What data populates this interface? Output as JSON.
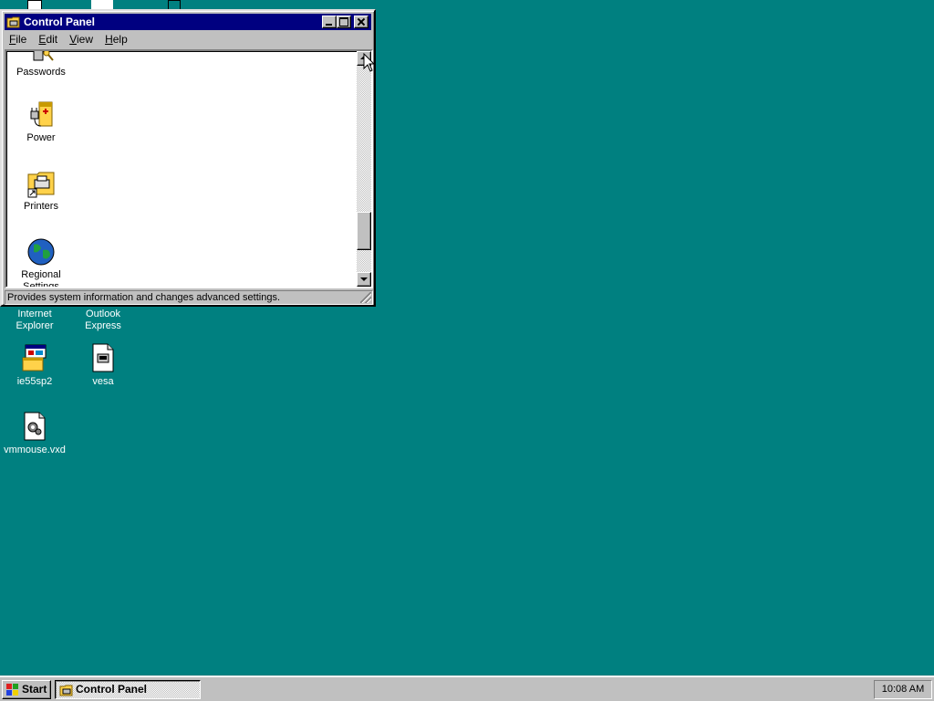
{
  "desktop": {
    "background_color": "#008080",
    "icons": [
      {
        "label_line1": "Internet",
        "label_line2": "Explorer",
        "icon": "internet-explorer-icon"
      },
      {
        "label_line1": "Outlook",
        "label_line2": "Express",
        "icon": "outlook-express-icon"
      },
      {
        "label_line1": "ie55sp2",
        "icon": "setup-program-icon"
      },
      {
        "label_line1": "vesa",
        "icon": "text-document-icon"
      },
      {
        "label_line1": "vmmouse.vxd",
        "icon": "system-file-icon"
      }
    ]
  },
  "window": {
    "title": "Control Panel",
    "title_icon": "control-panel-icon",
    "menu": [
      {
        "accel": "F",
        "rest": "ile"
      },
      {
        "accel": "E",
        "rest": "dit"
      },
      {
        "accel": "V",
        "rest": "iew"
      },
      {
        "accel": "H",
        "rest": "elp"
      }
    ],
    "items": [
      {
        "label": "Passwords",
        "icon": "passwords-keys-icon"
      },
      {
        "label": "Power",
        "icon": "power-plug-icon"
      },
      {
        "label": "Printers",
        "icon": "printers-folder-icon"
      },
      {
        "label_line1": "Regional",
        "label_line2": "Settings",
        "icon": "globe-icon"
      }
    ],
    "status_text": "Provides system information and changes advanced settings.",
    "accent_color": "#000080"
  },
  "taskbar": {
    "start_label": "Start",
    "task_label": "Control Panel",
    "clock": "10:08 AM"
  }
}
